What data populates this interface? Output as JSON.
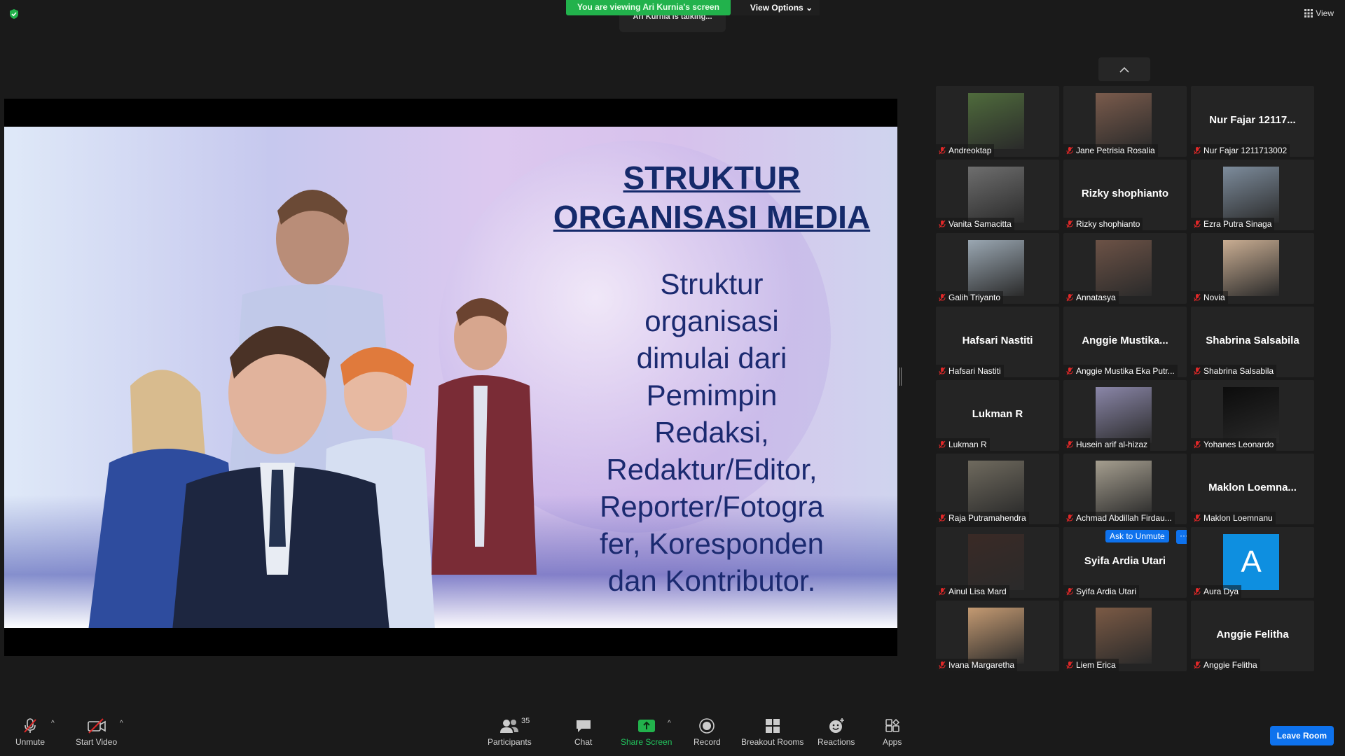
{
  "banner": {
    "viewing": "You are viewing Ari Kurnia's screen",
    "view_options": "View Options",
    "talking": "Ari Kurnia is talking..."
  },
  "view_button": "View",
  "slide": {
    "title_line1": "STRUKTUR",
    "title_line2": "ORGANISASI MEDIA",
    "body_lines": [
      "Struktur",
      "organisasi",
      "dimulai dari",
      "Pemimpin",
      "Redaksi,",
      "Redaktur/Editor,",
      "Reporter/Fotogra",
      "fer, Koresponden",
      "dan Kontributor."
    ]
  },
  "participants": [
    {
      "label": "Andreoktap",
      "big": "",
      "video": true
    },
    {
      "label": "Jane Petrisia Rosalia",
      "big": "",
      "video": true
    },
    {
      "label": "Nur Fajar 1211713002",
      "big": "Nur Fajar 12117...",
      "video": false
    },
    {
      "label": "Vanita Samacitta",
      "big": "",
      "video": true
    },
    {
      "label": "Rizky shophianto",
      "big": "Rizky shophianto",
      "video": false
    },
    {
      "label": "Ezra Putra Sinaga",
      "big": "",
      "video": true
    },
    {
      "label": "Galih Triyanto",
      "big": "",
      "video": true
    },
    {
      "label": "Annatasya",
      "big": "",
      "video": true
    },
    {
      "label": "Novia",
      "big": "",
      "video": true
    },
    {
      "label": "Hafsari Nastiti",
      "big": "Hafsari Nastiti",
      "video": false
    },
    {
      "label": "Anggie Mustika Eka Putr...",
      "big": "Anggie  Mustika...",
      "video": false
    },
    {
      "label": "Shabrina Salsabila",
      "big": "Shabrina Salsabila",
      "video": false
    },
    {
      "label": "Lukman R",
      "big": "Lukman R",
      "video": false
    },
    {
      "label": "Husein arif al-hizaz",
      "big": "",
      "video": true
    },
    {
      "label": "Yohanes Leonardo",
      "big": "",
      "video": true
    },
    {
      "label": "Raja Putramahendra",
      "big": "",
      "video": true
    },
    {
      "label": "Achmad Abdillah Firdau...",
      "big": "",
      "video": true
    },
    {
      "label": "Maklon Loemnanu",
      "big": "Maklon  Loemna...",
      "video": false
    },
    {
      "label": "Ainul Lisa Mard",
      "big": "",
      "video": true
    },
    {
      "label": "Syifa Ardia Utari",
      "big": "Syifa Ardia Utari",
      "video": false
    },
    {
      "label": "Aura Dya",
      "big": "",
      "video": false
    },
    {
      "label": "Ivana Margaretha",
      "big": "",
      "video": true
    },
    {
      "label": "Liem Erica",
      "big": "",
      "video": true
    },
    {
      "label": "Anggie Felitha",
      "big": "Anggie Felitha",
      "video": false
    }
  ],
  "ask_unmute": "Ask to Unmute",
  "ask_more": "···",
  "avatar_letter": "A",
  "toolbar": {
    "unmute": "Unmute",
    "start_video": "Start Video",
    "participants": "Participants",
    "participants_count": "35",
    "chat": "Chat",
    "share_screen": "Share Screen",
    "record": "Record",
    "breakout_rooms": "Breakout Rooms",
    "reactions": "Reactions",
    "apps": "Apps",
    "leave_room": "Leave Room"
  },
  "colors": {
    "accent_green": "#22b24c",
    "accent_blue": "#0e72ed",
    "muted_red": "#e02828"
  }
}
